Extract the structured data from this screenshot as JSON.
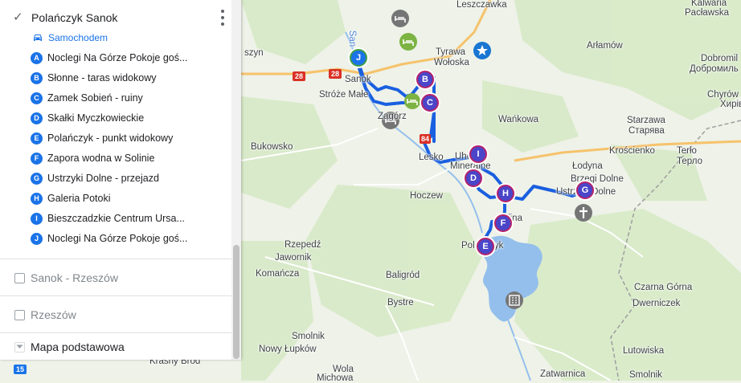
{
  "panel": {
    "layer1": {
      "title": "Polańczyk Sanok",
      "checked": true,
      "mode_label": "Samochodem",
      "stops": [
        {
          "letter": "A",
          "label": "Noclegi Na Górze Pokoje goś..."
        },
        {
          "letter": "B",
          "label": "Słonne - taras widokowy"
        },
        {
          "letter": "C",
          "label": "Zamek Sobień - ruiny"
        },
        {
          "letter": "D",
          "label": "Skałki Myczkowieckie"
        },
        {
          "letter": "E",
          "label": "Polańczyk - punkt widokowy"
        },
        {
          "letter": "F",
          "label": "Zapora wodna w Solinie"
        },
        {
          "letter": "G",
          "label": "Ustrzyki Dolne - przejazd"
        },
        {
          "letter": "H",
          "label": "Galeria Potoki"
        },
        {
          "letter": "I",
          "label": "Bieszczadzkie Centrum Ursa..."
        },
        {
          "letter": "J",
          "label": "Noclegi Na Górze Pokoje goś..."
        }
      ]
    },
    "layer2": {
      "title": "Sanok - Rzeszów",
      "checked": false
    },
    "layer3": {
      "title": "Rzeszów",
      "checked": false
    },
    "layer4": {
      "title": "Mapa podstawowa"
    }
  },
  "map": {
    "places": [
      {
        "id": "leszczawka",
        "label": "Leszczawka"
      },
      {
        "id": "kalwaria",
        "label": "Kalwaria"
      },
      {
        "id": "paclawska",
        "label": "Pacławska"
      },
      {
        "id": "tyrawa",
        "label": "Tyrawa"
      },
      {
        "id": "woloska",
        "label": "Wołoska"
      },
      {
        "id": "arlamow",
        "label": "Arłamów"
      },
      {
        "id": "dobromil",
        "label": "Dobromil"
      },
      {
        "id": "dobromil-uk",
        "label": "Добромиль"
      },
      {
        "id": "chyrow",
        "label": "Chyrów"
      },
      {
        "id": "chyrow-uk",
        "label": "Хирів"
      },
      {
        "id": "szyn",
        "label": "szyn"
      },
      {
        "id": "sanok",
        "label": "Sanok"
      },
      {
        "id": "stroze",
        "label": "Stróże Małe"
      },
      {
        "id": "zagorz",
        "label": "Zagórz"
      },
      {
        "id": "wankowa",
        "label": "Wańkowa"
      },
      {
        "id": "starzawa",
        "label": "Starzawa"
      },
      {
        "id": "starzawa-uk",
        "label": "Старява"
      },
      {
        "id": "krościenko",
        "label": "Krościenko"
      },
      {
        "id": "terlo",
        "label": "Terło"
      },
      {
        "id": "terlo-uk",
        "label": "Терло"
      },
      {
        "id": "bukowsko",
        "label": "Bukowsko"
      },
      {
        "id": "lesko",
        "label": "Lesko"
      },
      {
        "id": "uherce",
        "label": "Uherce"
      },
      {
        "id": "mineralne",
        "label": "Mineralne"
      },
      {
        "id": "lodyna",
        "label": "Łodyna"
      },
      {
        "id": "brzegi",
        "label": "Brzegi Dolne"
      },
      {
        "id": "ustrzyki",
        "label": "Ustrzyki Dolne"
      },
      {
        "id": "hoczew",
        "label": "Hoczew"
      },
      {
        "id": "solina",
        "label": "Solina"
      },
      {
        "id": "rzepedz",
        "label": "Rzepedź"
      },
      {
        "id": "jawornik",
        "label": "Jawornik"
      },
      {
        "id": "polanczyk",
        "label": "Polańczyk"
      },
      {
        "id": "komancza",
        "label": "Komańcza"
      },
      {
        "id": "baligrod",
        "label": "Baligród"
      },
      {
        "id": "czarna",
        "label": "Czarna Górna"
      },
      {
        "id": "bystre",
        "label": "Bystre"
      },
      {
        "id": "dwernik",
        "label": "Dwerniczek"
      },
      {
        "id": "smolnik1",
        "label": "Smolnik"
      },
      {
        "id": "lupkow",
        "label": "Nowy Łupków"
      },
      {
        "id": "lutowiska",
        "label": "Lutowiska"
      },
      {
        "id": "krasny",
        "label": "Krasny Bród"
      },
      {
        "id": "wola",
        "label": "Wola"
      },
      {
        "id": "michowa",
        "label": "Michowa"
      },
      {
        "id": "zatwarnica",
        "label": "Zatwarnica"
      },
      {
        "id": "smolnik2",
        "label": "Smolnik"
      },
      {
        "id": "san-river",
        "label": "San"
      }
    ],
    "road_shields": [
      {
        "id": "r28a",
        "label": "28"
      },
      {
        "id": "r28b",
        "label": "28"
      },
      {
        "id": "r15",
        "label": "15"
      },
      {
        "id": "r84",
        "label": "84"
      }
    ],
    "markers": [
      {
        "letter": "B"
      },
      {
        "letter": "C"
      },
      {
        "letter": "I"
      },
      {
        "letter": "D"
      },
      {
        "letter": "H"
      },
      {
        "letter": "F"
      },
      {
        "letter": "E"
      },
      {
        "letter": "G"
      },
      {
        "letter": "J"
      }
    ],
    "colors": {
      "route": "#1a5fe0",
      "marker_fill": "#4a45c9",
      "marker_ring": "#b3236a",
      "water": "#8fb8ee",
      "land": "#eef3e6",
      "forest": "#d6e9c6"
    }
  }
}
